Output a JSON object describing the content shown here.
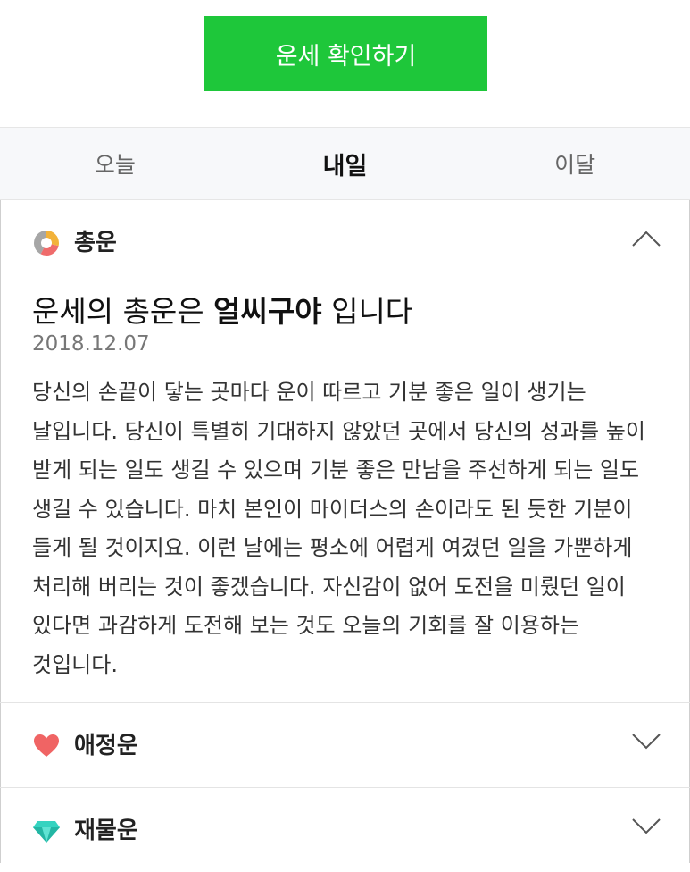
{
  "cta": {
    "label": "운세 확인하기"
  },
  "tabs": [
    {
      "label": "오늘"
    },
    {
      "label": "내일"
    },
    {
      "label": "이달"
    }
  ],
  "active_tab": "내일",
  "sections": {
    "overall": {
      "label": "총운",
      "icon": "donut-chart-icon",
      "expanded": true,
      "headline_prefix": "운세의 총운은 ",
      "headline_bold": "얼씨구야",
      "headline_suffix": " 입니다",
      "date": "2018.12.07",
      "body": "당신의 손끝이 닿는 곳마다 운이 따르고 기분 좋은 일이 생기는 날입니다. 당신이 특별히 기대하지 않았던 곳에서 당신의 성과를 높이 받게 되는 일도 생길 수 있으며 기분 좋은 만남을 주선하게 되는 일도 생길 수 있습니다. 마치 본인이 마이더스의 손이라도 된 듯한 기분이 들게 될 것이지요. 이런 날에는 평소에 어렵게 여겼던 일을 가뿐하게 처리해 버리는 것이 좋겠습니다. 자신감이 없어 도전을 미뤘던 일이 있다면 과감하게 도전해 보는 것도 오늘의 기회를 잘 이용하는 것입니다."
    },
    "love": {
      "label": "애정운",
      "icon": "heart-icon",
      "expanded": false
    },
    "wealth": {
      "label": "재물운",
      "icon": "diamond-icon",
      "expanded": false
    }
  },
  "colors": {
    "cta_green": "#1ec73a",
    "heart": "#f06464",
    "diamond": "#35d3c0"
  }
}
